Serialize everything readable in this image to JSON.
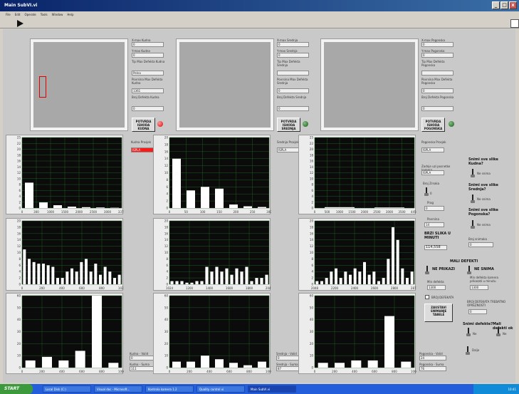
{
  "window": {
    "title": "Main SubVI.vi",
    "controls": [
      "_",
      "□",
      "x"
    ]
  },
  "menu": [
    "File",
    "Edit",
    "Operate",
    "Tools",
    "Window",
    "Help"
  ],
  "columns": [
    {
      "fields": [
        {
          "label": "X-max Kudna",
          "value": "0"
        },
        {
          "label": "Y-max Kudna",
          "value": "0"
        },
        {
          "label": "Tip Max Defekta Kudna",
          "value": "Pelna"
        },
        {
          "label": "Povrsina Max Defekta Kudna",
          "value": "1361"
        },
        {
          "label": "Broj Defekta Kudna",
          "value": "0"
        }
      ],
      "button": "POTVRDA ISHODA KUDNA",
      "led": "red",
      "result": {
        "label": "Kudna Prosjek",
        "value": "ISPLA",
        "status_color": "#ff1a1a"
      },
      "bottom": [
        {
          "label": "Kudna - Valid",
          "value": "0"
        },
        {
          "label": "Kudna - Suma",
          "value": "111"
        }
      ]
    },
    {
      "fields": [
        {
          "label": "X-max Srednja",
          "value": "0"
        },
        {
          "label": "Y-max Srednja",
          "value": "0"
        },
        {
          "label": "Tip Max Defekta Srednja",
          "value": ""
        },
        {
          "label": "Povrsina Max Defekta Srednja",
          "value": "0"
        },
        {
          "label": "Broj Defekta Srednja",
          "value": "0"
        }
      ],
      "button": "POTVRDA ISHODA SREDNJA",
      "led": "green",
      "result": {
        "label": "Srednja Prosjek",
        "value": "ISPLA"
      },
      "bottom": [
        {
          "label": "Srednja - Valid",
          "value": "0"
        },
        {
          "label": "Srednja - Suma",
          "value": "87"
        }
      ]
    },
    {
      "fields": [
        {
          "label": "X-max Pogonska",
          "value": "0"
        },
        {
          "label": "Y-max Pogonska",
          "value": "0"
        },
        {
          "label": "Tip Max Defekta Pogonska",
          "value": ""
        },
        {
          "label": "Povrsina Max Defekta Pogonska",
          "value": "0"
        },
        {
          "label": "Broj Defekta Pogonska",
          "value": "0"
        }
      ],
      "button": "POTVRDA ISHODA POGONSKA",
      "led": "green",
      "result": {
        "label": "Pogonska Prosjek",
        "value": "ISPLA"
      },
      "bottom": [
        {
          "label": "Pogonska - Valid",
          "value": "24"
        },
        {
          "label": "Pogonska - Suma",
          "value": "76"
        }
      ]
    }
  ],
  "right": {
    "zadnji_label": "Zadnje uzi posnetke kamera",
    "zadnji_value": "ISPLA",
    "broj_zrnaka": "Broj Zrnaka",
    "prag_label": "Prag",
    "prag_value": "0",
    "povrsina_label": "Povrsina",
    "povrsina_value": "14",
    "brzi_label": "BRZI SLIKA U MINUTI",
    "brzi_value": "114,558",
    "snimi_kudna": "Snimi sve slike Kudna?",
    "snimi_srednja": "Snimi sve slike Srednja?",
    "snimi_pogonska": "Snimi sve slike Pogonska?",
    "ne_snima": "Ne snima",
    "broj_snimaka": "Broj snimaka",
    "broj_snimaka_value": "0",
    "mali_defekti": "MALI DEFEKTI",
    "ne_prikazi": "NE PRIKAZI",
    "ne_snima2": "NE SNIMA",
    "min_defekt": "Min defekta",
    "min_defekt_value": "1300",
    "min_defekt_kamera": "Min defekta kamera prikazati u minutu",
    "min_defekt_kamera_value": "1300",
    "broj_defekata": "BROJ DEFEKATA",
    "broj_defekta_max": "BROJ DEFEKATA TREBATNO OPREZNOSTI",
    "broj_defekta_max_value": "0",
    "zaustavi": "ZAUSTAVI SNIMANJE TABELE",
    "snimi_defekte": "Snimi defekte?",
    "mali_defekti_ok": "Mali defekti ok",
    "ne": "Ne",
    "dalje": "Dalje"
  },
  "chart_data": [
    {
      "type": "bar",
      "title": "",
      "xlim": [
        0,
        3375
      ],
      "ylim": [
        0,
        25
      ],
      "xticks": [
        "0",
        "300",
        "1000",
        "1500",
        "2000",
        "2500",
        "3000",
        "3375"
      ],
      "yticks": [
        "0",
        "2",
        "4",
        "6",
        "8",
        "10",
        "12",
        "14",
        "16",
        "18",
        "20",
        "22",
        "25"
      ],
      "values": [
        9,
        2,
        1,
        0.5,
        0.3,
        0.2,
        0.1
      ]
    },
    {
      "type": "bar",
      "title": "",
      "xlim": [
        0,
        300
      ],
      "ylim": [
        0,
        20
      ],
      "xticks": [
        "0",
        "50",
        "100",
        "150",
        "200",
        "250",
        "300"
      ],
      "yticks": [
        "0",
        "2",
        "4",
        "6",
        "8",
        "10",
        "12",
        "14",
        "16",
        "18",
        "20"
      ],
      "values": [
        14,
        5,
        6,
        5.5,
        1,
        0.5,
        0.3
      ]
    },
    {
      "type": "bar",
      "title": "",
      "xlim": [
        0,
        4450
      ],
      "ylim": [
        0,
        25
      ],
      "xticks": [
        "0",
        "500",
        "1000",
        "1500",
        "2000",
        "2500",
        "3000",
        "3500",
        "4450"
      ],
      "yticks": [
        "0",
        "2",
        "4",
        "6",
        "8",
        "10",
        "12",
        "14",
        "16",
        "18",
        "20",
        "22",
        "25"
      ],
      "values": [
        0.3,
        0.2
      ]
    },
    {
      "type": "bar",
      "title": "",
      "xlim": [
        0,
        1023
      ],
      "ylim": [
        0,
        20
      ],
      "xticks": [
        "0",
        "200",
        "400",
        "600",
        "800",
        "1023"
      ],
      "yticks": [
        "0",
        "2",
        "4",
        "6",
        "8",
        "10",
        "12",
        "14",
        "16",
        "18",
        "20"
      ],
      "values": [
        11,
        8,
        7,
        6.5,
        6.5,
        6,
        5.5,
        2,
        2,
        4,
        5,
        4,
        7,
        8,
        4,
        6.5,
        3,
        5.5,
        4,
        2,
        3
      ]
    },
    {
      "type": "bar",
      "title": "",
      "xlim": [
        1024,
        2047
      ],
      "ylim": [
        0,
        20
      ],
      "xticks": [
        "1024",
        "1200",
        "1400",
        "1600",
        "1800",
        "2047"
      ],
      "yticks": [
        "0",
        "2",
        "4",
        "6",
        "8",
        "10",
        "12",
        "14",
        "16",
        "18",
        "20"
      ],
      "values": [
        1,
        1,
        1,
        0.5,
        0.5,
        1,
        1,
        5.5,
        4,
        5.5,
        4,
        5,
        3,
        5,
        4,
        5.5,
        1,
        2,
        2,
        3
      ]
    },
    {
      "type": "bar",
      "title": "",
      "xlim": [
        2048,
        2873
      ],
      "ylim": [
        0,
        20
      ],
      "xticks": [
        "2048",
        "2200",
        "2400",
        "2600",
        "2800",
        "2873"
      ],
      "yticks": [
        "0",
        "2",
        "4",
        "6",
        "8",
        "10",
        "12",
        "14",
        "16",
        "18",
        "20"
      ],
      "values": [
        1,
        1,
        2,
        4,
        5,
        2,
        4,
        3,
        5,
        4,
        7,
        3,
        4,
        1,
        2,
        8,
        18,
        14,
        5,
        2,
        4
      ]
    },
    {
      "type": "bar",
      "title": "",
      "xlim": [
        0,
        1000
      ],
      "ylim": [
        0,
        60
      ],
      "xticks": [
        "0",
        "200",
        "400",
        "600",
        "800",
        "1000"
      ],
      "yticks": [
        "0",
        "10",
        "20",
        "30",
        "40",
        "50",
        "60"
      ],
      "values": [
        6,
        9,
        6,
        14,
        61,
        4
      ]
    },
    {
      "type": "bar",
      "title": "",
      "xlim": [
        0,
        1000
      ],
      "ylim": [
        0,
        60
      ],
      "xticks": [
        "0",
        "200",
        "400",
        "600",
        "800",
        "1000"
      ],
      "yticks": [
        "0",
        "10",
        "20",
        "30",
        "40",
        "50",
        "60"
      ],
      "values": [
        5,
        5,
        10,
        7,
        4,
        2,
        5
      ]
    },
    {
      "type": "bar",
      "title": "",
      "xlim": [
        0,
        1000
      ],
      "ylim": [
        0,
        60
      ],
      "xticks": [
        "0",
        "200",
        "400",
        "600",
        "800",
        "1000"
      ],
      "yticks": [
        "0",
        "10",
        "20",
        "30",
        "40",
        "50",
        "60"
      ],
      "values": [
        4,
        4,
        6,
        6,
        43,
        5
      ]
    }
  ],
  "taskbar": {
    "start": "START",
    "tasks": [
      "Local Disk (C:)",
      "Visual doc - Microsoft...",
      "Kontrola kamera 1.2",
      "Quality control vi",
      "Main SubVI.vi"
    ],
    "clock": "10:41"
  }
}
